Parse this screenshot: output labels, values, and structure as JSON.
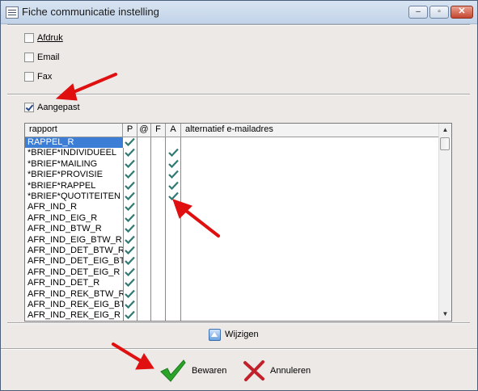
{
  "window": {
    "title": "Fiche communicatie instelling"
  },
  "titlebar_buttons": {
    "minimize": "–",
    "maximize": "▫",
    "close": "✕"
  },
  "options": [
    {
      "label": "Afdruk",
      "checked": false
    },
    {
      "label": "Email",
      "checked": false
    },
    {
      "label": "Fax",
      "checked": false
    }
  ],
  "aangepast": {
    "label": "Aangepast",
    "checked": true
  },
  "grid": {
    "columns": [
      "rapport",
      "P",
      "@",
      "F",
      "A",
      "alternatief e-mailadres"
    ],
    "rows": [
      {
        "rapport": "RAPPEL_R",
        "P": true,
        "A": false,
        "selected": true
      },
      {
        "rapport": "*BRIEF*INDIVIDUEEL",
        "P": true,
        "A": true
      },
      {
        "rapport": "*BRIEF*MAILING",
        "P": true,
        "A": true
      },
      {
        "rapport": "*BRIEF*PROVISIE",
        "P": true,
        "A": true
      },
      {
        "rapport": "*BRIEF*RAPPEL",
        "P": true,
        "A": true
      },
      {
        "rapport": "*BRIEF*QUOTITEITEN",
        "P": true,
        "A": true
      },
      {
        "rapport": "AFR_IND_R",
        "P": true,
        "A": false
      },
      {
        "rapport": "AFR_IND_EIG_R",
        "P": true,
        "A": false
      },
      {
        "rapport": "AFR_IND_BTW_R",
        "P": true,
        "A": false
      },
      {
        "rapport": "AFR_IND_EIG_BTW_R",
        "P": true,
        "A": false
      },
      {
        "rapport": "AFR_IND_DET_BTW_R",
        "P": true,
        "A": false
      },
      {
        "rapport": "AFR_IND_DET_EIG_BT",
        "P": true,
        "A": false
      },
      {
        "rapport": "AFR_IND_DET_EIG_R",
        "P": true,
        "A": false
      },
      {
        "rapport": "AFR_IND_DET_R",
        "P": true,
        "A": false
      },
      {
        "rapport": "AFR_IND_REK_BTW_R",
        "P": true,
        "A": false
      },
      {
        "rapport": "AFR_IND_REK_EIG_BT",
        "P": true,
        "A": false
      },
      {
        "rapport": "AFR_IND_REK_EIG_R",
        "P": true,
        "A": false
      }
    ]
  },
  "wijzigen": {
    "label": "Wijzigen"
  },
  "buttons": {
    "save": "Bewaren",
    "cancel": "Annuleren"
  },
  "colors": {
    "selection": "#3c7ed6",
    "check": "#2f7a73",
    "save": "#2aa52a",
    "cancel": "#c2202a",
    "arrow": "#e01010"
  }
}
